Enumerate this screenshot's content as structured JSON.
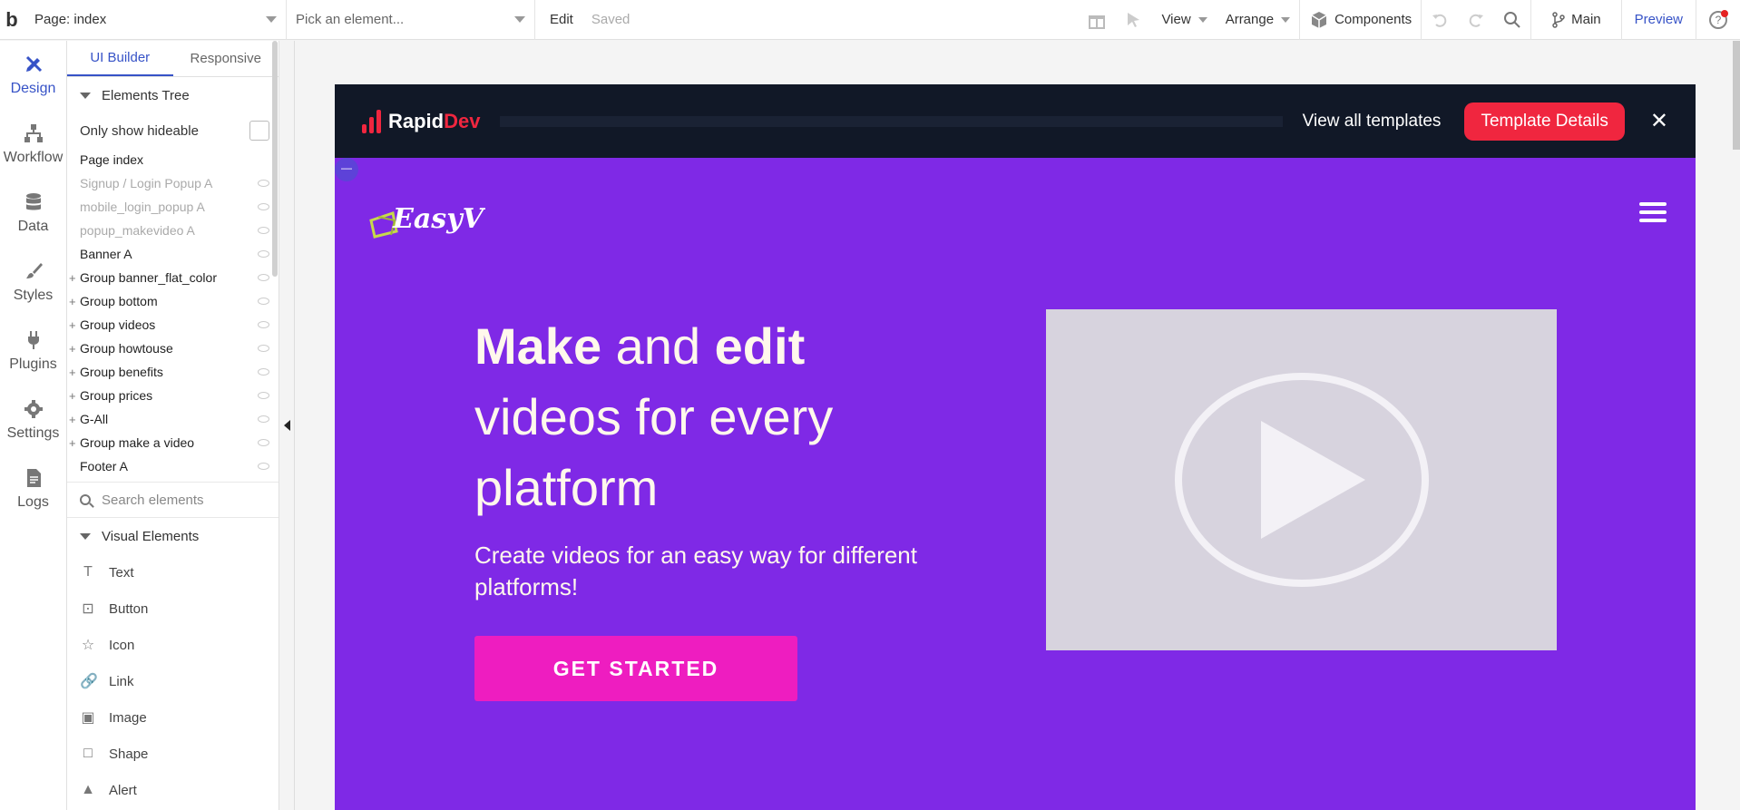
{
  "topbar": {
    "page_select": "Page: index",
    "element_picker_placeholder": "Pick an element...",
    "edit": "Edit",
    "saved": "Saved",
    "view": "View",
    "arrange": "Arrange",
    "components": "Components",
    "branch": "Main",
    "preview": "Preview"
  },
  "leftnav": {
    "items": [
      {
        "label": "Design",
        "icon": "design-icon"
      },
      {
        "label": "Workflow",
        "icon": "workflow-icon"
      },
      {
        "label": "Data",
        "icon": "database-icon"
      },
      {
        "label": "Styles",
        "icon": "brush-icon"
      },
      {
        "label": "Plugins",
        "icon": "plug-icon"
      },
      {
        "label": "Settings",
        "icon": "gear-icon"
      },
      {
        "label": "Logs",
        "icon": "logs-icon"
      }
    ]
  },
  "panel": {
    "tabs": [
      "UI Builder",
      "Responsive"
    ],
    "elements_tree_label": "Elements Tree",
    "only_hideable_label": "Only show hideable",
    "tree": [
      {
        "label": "Page index",
        "dim": false,
        "plus": false,
        "eye": false
      },
      {
        "label": "Signup / Login Popup A",
        "dim": true,
        "plus": false,
        "eye": true
      },
      {
        "label": "mobile_login_popup A",
        "dim": true,
        "plus": false,
        "eye": true
      },
      {
        "label": "popup_makevideo A",
        "dim": true,
        "plus": false,
        "eye": true
      },
      {
        "label": "Banner A",
        "dim": false,
        "plus": false,
        "eye": true
      },
      {
        "label": "Group banner_flat_color",
        "dim": false,
        "plus": true,
        "eye": true
      },
      {
        "label": "Group bottom",
        "dim": false,
        "plus": true,
        "eye": true
      },
      {
        "label": "Group videos",
        "dim": false,
        "plus": true,
        "eye": true
      },
      {
        "label": "Group howtouse",
        "dim": false,
        "plus": true,
        "eye": true
      },
      {
        "label": "Group benefits",
        "dim": false,
        "plus": true,
        "eye": true
      },
      {
        "label": "Group prices",
        "dim": false,
        "plus": true,
        "eye": true
      },
      {
        "label": "G-All",
        "dim": false,
        "plus": true,
        "eye": true
      },
      {
        "label": "Group make a video",
        "dim": false,
        "plus": true,
        "eye": true
      },
      {
        "label": "Footer A",
        "dim": false,
        "plus": false,
        "eye": true
      }
    ],
    "search_placeholder": "Search elements",
    "visual_elements_label": "Visual Elements",
    "visual_elements": [
      {
        "label": "Text",
        "icon": "T"
      },
      {
        "label": "Button",
        "icon": "⊡"
      },
      {
        "label": "Icon",
        "icon": "☆"
      },
      {
        "label": "Link",
        "icon": "🔗"
      },
      {
        "label": "Image",
        "icon": "▣"
      },
      {
        "label": "Shape",
        "icon": "□"
      },
      {
        "label": "Alert",
        "icon": "▲"
      }
    ]
  },
  "preview": {
    "rapiddev_brand_a": "Rapid",
    "rapiddev_brand_b": "Dev",
    "view_all_templates": "View all templates",
    "template_details": "Template Details",
    "close": "✕",
    "easyv_logo_text": "EasyV",
    "hero_word_1": "Make",
    "hero_word_2": " and ",
    "hero_word_3": "edit",
    "hero_rest": "videos for every platform",
    "hero_subtitle": "Create videos for an easy way for different platforms!",
    "cta_label": "GET STARTED"
  },
  "colors": {
    "accent": "#3753c7",
    "hero_bg": "#7f29e6",
    "cta_bg": "#ee1dc0",
    "rapiddev_red": "#f0263f",
    "rapiddev_bar": "#111827"
  }
}
